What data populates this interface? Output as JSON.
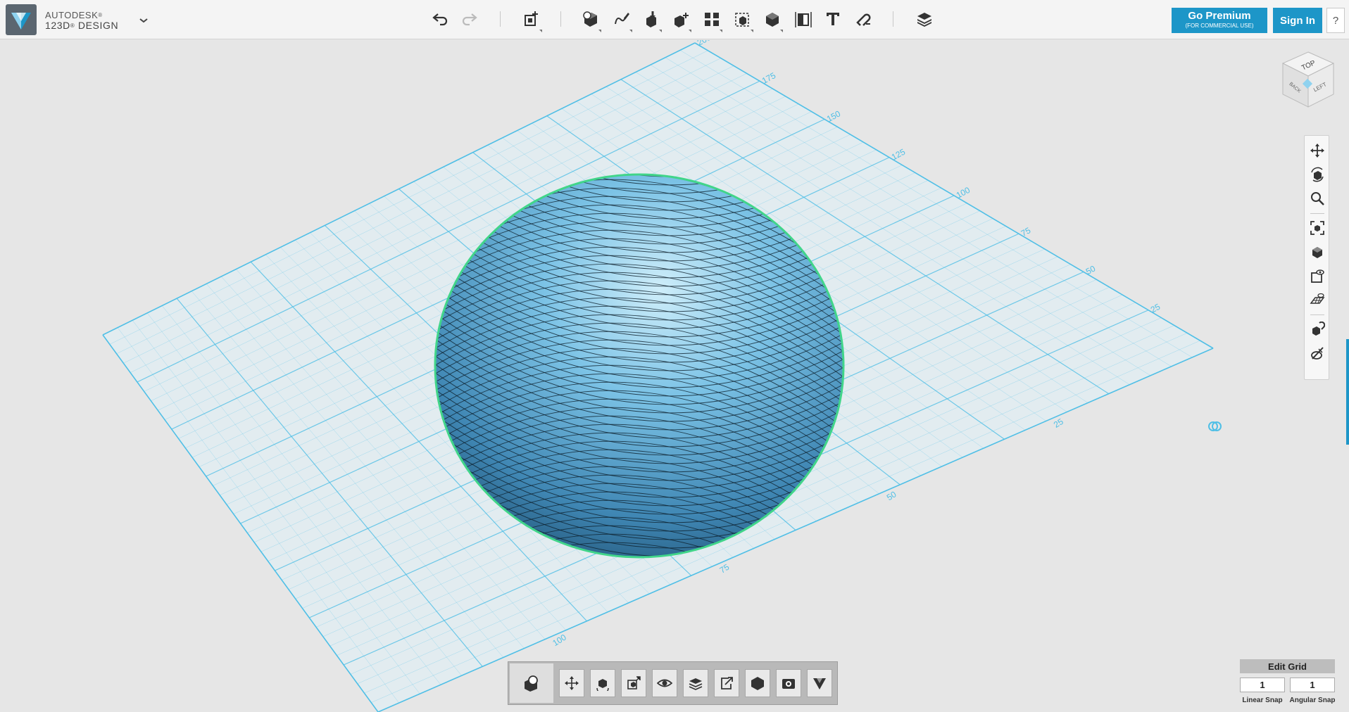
{
  "brand": {
    "company": "AUTODESK",
    "product": "123D",
    "product_suffix": "DESIGN",
    "trademark": "®"
  },
  "colors": {
    "accent": "#1d96c8",
    "grid": "#4fbfe6",
    "solid": "#4c97c4",
    "selection": "#41d58a"
  },
  "toolbar": {
    "buttons": [
      {
        "name": "undo-button",
        "icon": "undo-icon"
      },
      {
        "name": "redo-button",
        "icon": "redo-icon"
      },
      {
        "name": "transform-button",
        "icon": "transform-icon"
      },
      {
        "name": "primitives-button",
        "icon": "primitives-icon"
      },
      {
        "name": "sketch-button",
        "icon": "sketch-icon"
      },
      {
        "name": "construct-button",
        "icon": "construct-icon"
      },
      {
        "name": "modify-button",
        "icon": "modify-icon"
      },
      {
        "name": "pattern-button",
        "icon": "pattern-icon"
      },
      {
        "name": "grouping-button",
        "icon": "grouping-icon"
      },
      {
        "name": "combine-button",
        "icon": "combine-icon"
      },
      {
        "name": "measure-button",
        "icon": "measure-icon"
      },
      {
        "name": "text-button",
        "icon": "text-icon"
      },
      {
        "name": "snap-button",
        "icon": "snap-icon"
      },
      {
        "name": "material-button",
        "icon": "material-icon"
      }
    ],
    "premium_label": "Go Premium",
    "premium_sub": "(FOR COMMERCIAL USE)",
    "signin_label": "Sign In",
    "help_label": "?"
  },
  "viewcube": {
    "top": "TOP",
    "left": "LEFT",
    "back": "BACK"
  },
  "grid_labels": {
    "back_axis": [
      "200",
      "175",
      "150",
      "125",
      "100",
      "75",
      "50",
      "25"
    ],
    "front_axis": [
      "25",
      "50",
      "75",
      "100"
    ]
  },
  "nav": [
    "pan-icon",
    "orbit-icon",
    "zoom-icon",
    "fit-icon",
    "view-icon",
    "visibility-icon",
    "grid-icon",
    "object-snap-icon",
    "materials-outline-icon"
  ],
  "bottombar": [
    "primitives-quick-icon",
    "move-icon",
    "orbit-view-icon",
    "fit-selection-icon",
    "eye-icon",
    "layers-icon",
    "export-icon",
    "solid-icon",
    "camera-icon",
    "visual-style-icon"
  ],
  "grid_controls": {
    "edit_label": "Edit Grid",
    "linear_value": "1",
    "angular_value": "1",
    "linear_label": "Linear Snap",
    "angular_label": "Angular Snap"
  }
}
